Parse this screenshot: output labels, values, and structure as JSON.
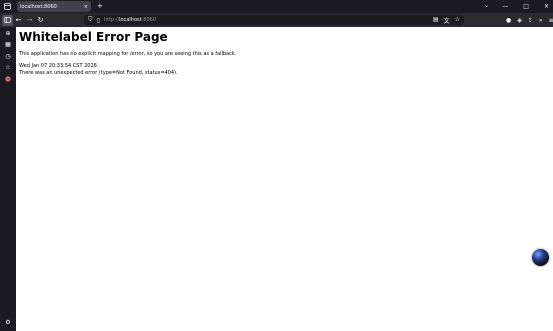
{
  "browser": {
    "tab": {
      "title": "localhost:8060",
      "close": "×"
    },
    "new_tab": "+",
    "url": {
      "prefix": "http://",
      "host": "localhost",
      "port": ":8060"
    },
    "window_controls": {
      "list": "⌄",
      "minimize": "—",
      "maximize": "□",
      "close": "×"
    }
  },
  "page": {
    "heading": "Whitelabel Error Page",
    "message": "This application has no explicit mapping for /error, so you are seeing this as a fallback.",
    "timestamp": "Wed Jan 07 20:33:54 CST 2026",
    "error": "There was an unexpected error (type=Not Found, status=404)."
  },
  "icons": {
    "back": "←",
    "forward": "→",
    "reload": "↻",
    "shield": "⛉",
    "page": "▯",
    "reader": "▤",
    "translate": "文",
    "star": "☆",
    "account": "●",
    "shield2": "◈",
    "share": "⇪",
    "more": "»",
    "menu": "≡",
    "extensions": "⊕",
    "history": "◷",
    "bookmarks": "☆",
    "tab-groups": "▦",
    "settings": "⚙"
  }
}
